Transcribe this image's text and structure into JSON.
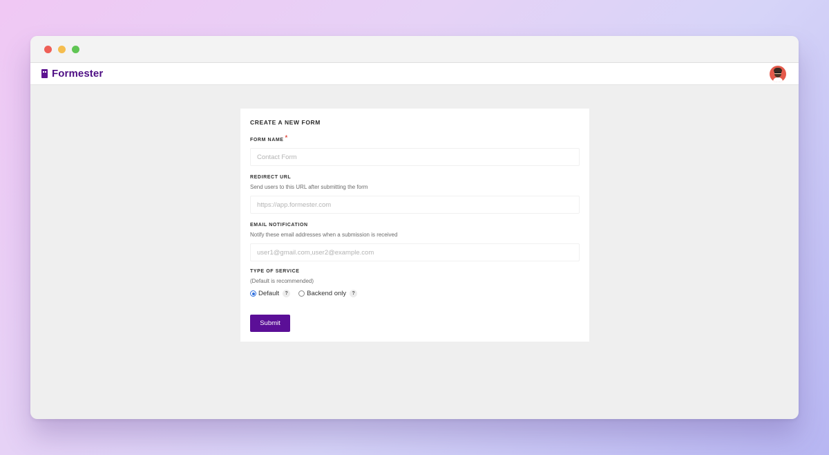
{
  "app": {
    "brand_name": "Formester",
    "brand_color": "#5b0f97",
    "avatar_icon": "user-avatar"
  },
  "form": {
    "title": "CREATE A NEW FORM",
    "form_name": {
      "label": "FORM NAME",
      "required_mark": "*",
      "placeholder": "Contact Form",
      "value": ""
    },
    "redirect_url": {
      "label": "REDIRECT URL",
      "help": "Send users to this URL after submitting the form",
      "placeholder": "https://app.formester.com",
      "value": ""
    },
    "email_notification": {
      "label": "EMAIL NOTIFICATION",
      "help": "Notify these email addresses when a submission is received",
      "placeholder": "user1@gmail.com,user2@example.com",
      "value": ""
    },
    "service_type": {
      "label": "TYPE OF SERVICE",
      "help": "(Default is recommended)",
      "options": [
        {
          "label": "Default",
          "selected": true,
          "hint": "?"
        },
        {
          "label": "Backend only",
          "selected": false,
          "hint": "?"
        }
      ]
    },
    "submit_label": "Submit"
  }
}
